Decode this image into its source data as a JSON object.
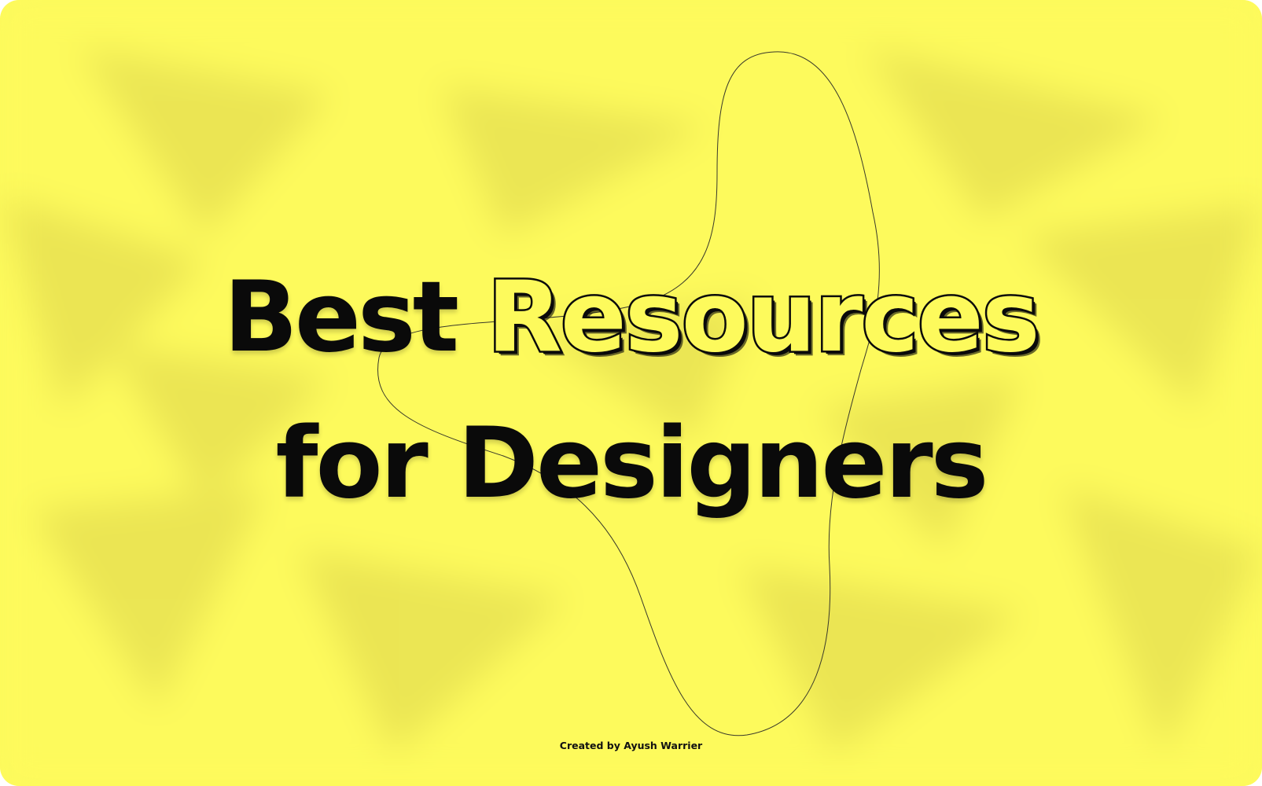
{
  "headline": {
    "line1_word1": "Best",
    "line1_word2": "Resources",
    "line2_word1": "for",
    "line2_word2": "Designers"
  },
  "footer": {
    "credit": "Created by Ayush Warrier"
  },
  "colors": {
    "background": "#fdfa5c",
    "pattern_shade": "#e8e252",
    "text": "#0a0a0a",
    "blob_stroke": "#3a3a2a"
  }
}
